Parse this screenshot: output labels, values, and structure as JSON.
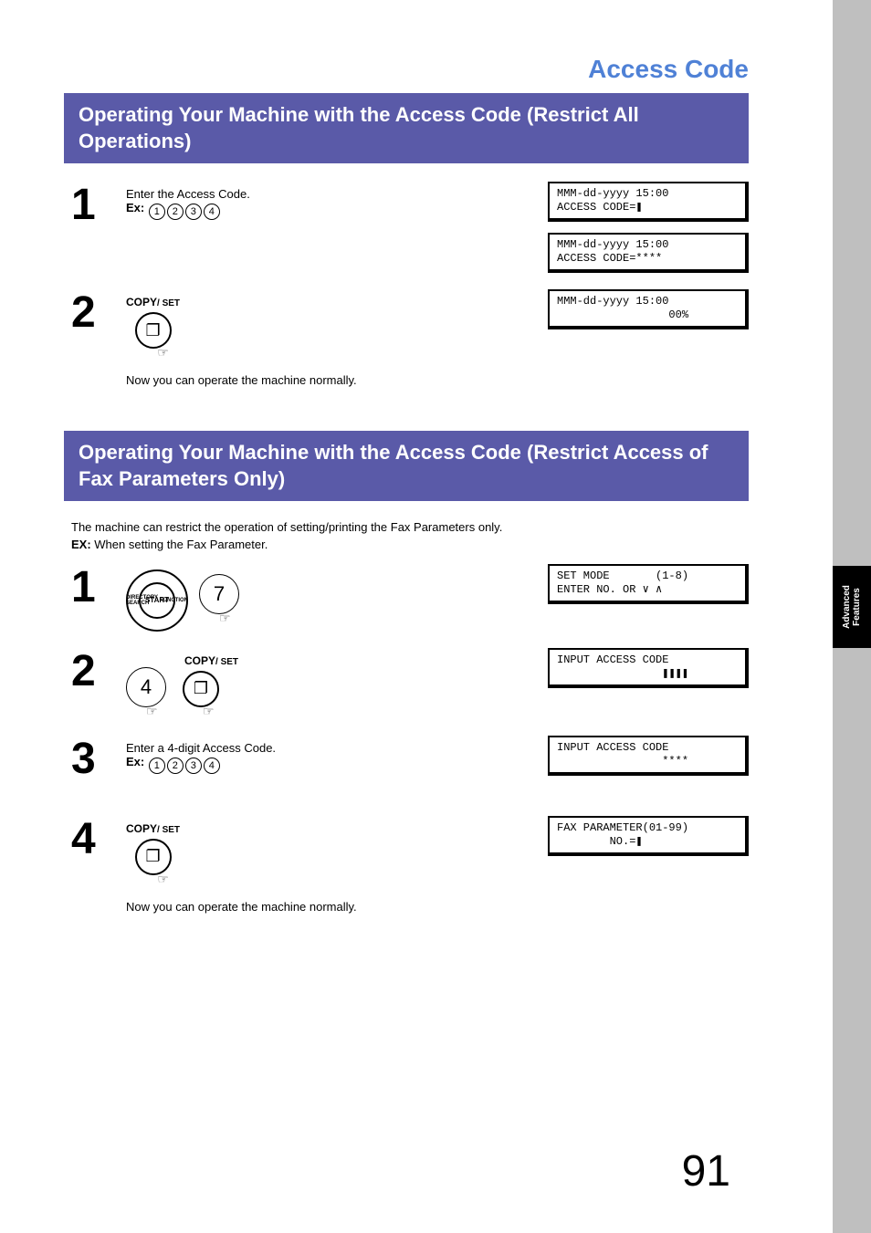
{
  "page": {
    "title": "Access Code",
    "number": "91",
    "side_tab_line1": "Advanced",
    "side_tab_line2": "Features"
  },
  "section1": {
    "header": "Operating Your Machine with the Access Code (Restrict All Operations)",
    "step1": {
      "num": "1",
      "line1": "Enter the Access Code.",
      "ex_label": "Ex:",
      "keys": [
        "1",
        "2",
        "3",
        "4"
      ],
      "lcd1": "MMM-dd-yyyy 15:00\nACCESS CODE=❚",
      "lcd2": "MMM-dd-yyyy 15:00\nACCESS CODE=****"
    },
    "step2": {
      "num": "2",
      "btn_label_copy": "COPY",
      "btn_label_set": "/ SET",
      "btn_glyph": "❐",
      "lcd": "MMM-dd-yyyy 15:00\n                 00%",
      "after": "Now you can operate the machine normally."
    }
  },
  "section2": {
    "header": "Operating Your Machine with the Access Code (Restrict Access of Fax Parameters Only)",
    "intro_line1": "The machine can restrict the operation of setting/printing the Fax Parameters only.",
    "intro_ex_label": "EX:",
    "intro_ex_text": " When setting the Fax Parameter.",
    "step1": {
      "num": "1",
      "func_start": "START",
      "func_left": "DIRECTORY\nSEARCH",
      "func_right": "FUNCTION",
      "key7": "7",
      "lcd": "SET MODE       (1-8)\nENTER NO. OR ∨ ∧"
    },
    "step2": {
      "num": "2",
      "key4": "4",
      "btn_label_copy": "COPY",
      "btn_label_set": "/ SET",
      "btn_glyph": "❐",
      "lcd": "INPUT ACCESS CODE\n                ❚❚❚❚"
    },
    "step3": {
      "num": "3",
      "line1": "Enter a 4-digit Access Code.",
      "ex_label": "Ex:",
      "keys": [
        "1",
        "2",
        "3",
        "4"
      ],
      "lcd": "INPUT ACCESS CODE\n                ****"
    },
    "step4": {
      "num": "4",
      "btn_label_copy": "COPY",
      "btn_label_set": "/ SET",
      "btn_glyph": "❐",
      "lcd": "FAX PARAMETER(01-99)\n        NO.=❚",
      "after": "Now you can operate the machine normally."
    }
  }
}
